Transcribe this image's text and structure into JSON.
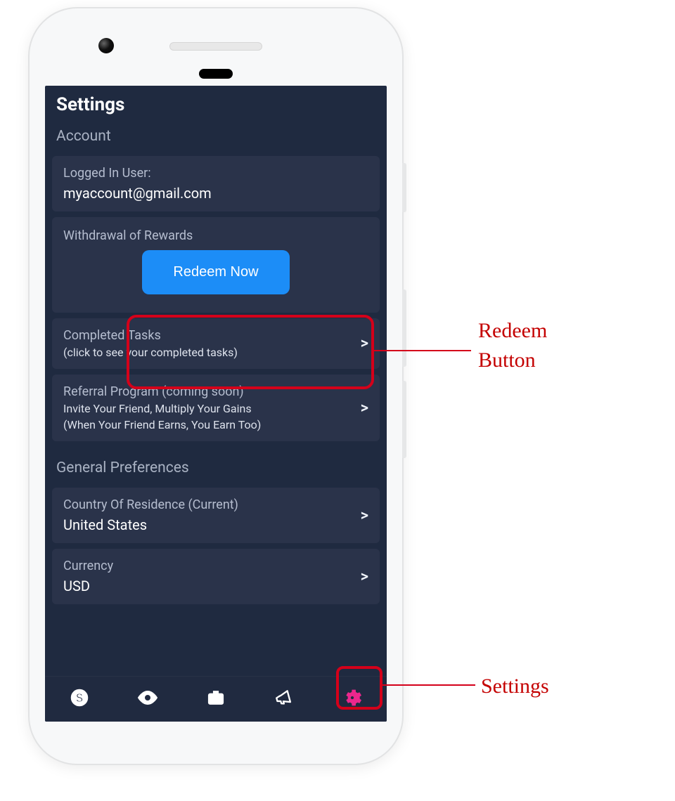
{
  "page": {
    "title": "Settings"
  },
  "account": {
    "section_label": "Account",
    "logged_in_label": "Logged In User:",
    "logged_in_value": "myaccount@gmail.com",
    "withdrawal_label": "Withdrawal of Rewards",
    "redeem_button": "Redeem Now",
    "completed_label": "Completed Tasks",
    "completed_sub": "(click to see your completed tasks)",
    "referral_label": "Referral Program (coming soon)",
    "referral_sub1": "Invite Your Friend, Multiply Your Gains",
    "referral_sub2": "(When Your Friend Earns, You Earn Too)"
  },
  "general": {
    "section_label": "General Preferences",
    "country_label": "Country Of Residence (Current)",
    "country_value": "United States",
    "currency_label": "Currency",
    "currency_value": "USD"
  },
  "chevron": ">",
  "callouts": {
    "redeem_line1": "Redeem",
    "redeem_line2": "Button",
    "settings": "Settings"
  },
  "colors": {
    "screen_bg": "#1f2a40",
    "card_bg": "#2a334a",
    "accent_blue": "#1c8df7",
    "accent_pink": "#ec278d",
    "callout_red": "#d4001a"
  }
}
